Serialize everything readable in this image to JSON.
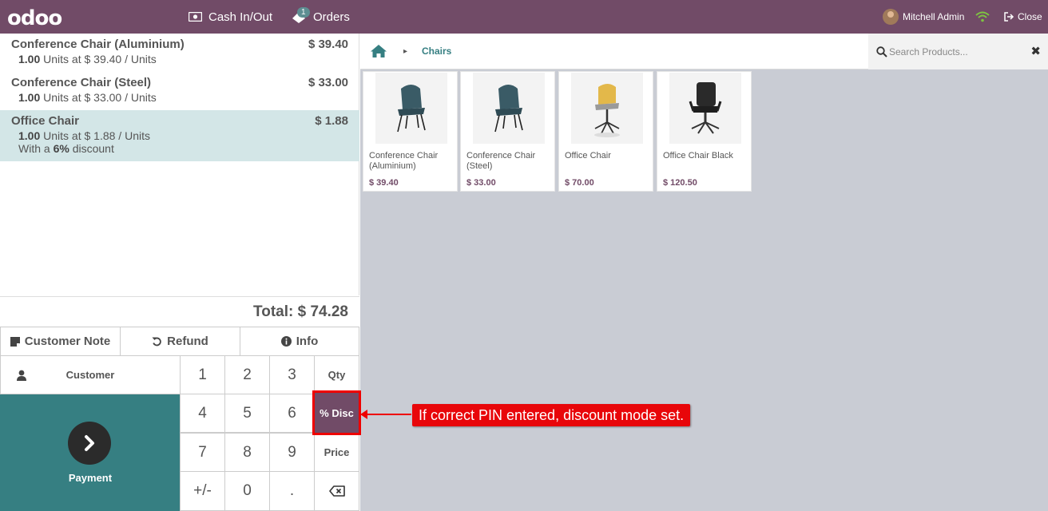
{
  "topbar": {
    "logo": "odoo",
    "cash_label": "Cash In/Out",
    "orders_label": "Orders",
    "orders_badge": "1",
    "user_name": "Mitchell Admin",
    "close_label": "Close"
  },
  "order": {
    "lines": [
      {
        "name": "Conference Chair (Aluminium)",
        "price": "$ 39.40",
        "qty": "1.00",
        "unit_info": "Units at $ 39.40 / Units"
      },
      {
        "name": "Conference Chair (Steel)",
        "price": "$ 33.00",
        "qty": "1.00",
        "unit_info": "Units at $ 33.00 / Units"
      },
      {
        "name": "Office Chair",
        "price": "$ 1.88",
        "qty": "1.00",
        "unit_info": "Units at $ 1.88 / Units",
        "disc_prefix": "With a",
        "disc_value": "6%",
        "disc_suffix": "discount"
      }
    ],
    "total": "Total: $ 74.28"
  },
  "controls": {
    "customer_note": "Customer Note",
    "refund": "Refund",
    "info": "Info",
    "customer": "Customer",
    "payment": "Payment"
  },
  "numpad": {
    "k1": "1",
    "k2": "2",
    "k3": "3",
    "qty": "Qty",
    "k4": "4",
    "k5": "5",
    "k6": "6",
    "disc": "% Disc",
    "k7": "7",
    "k8": "8",
    "k9": "9",
    "price": "Price",
    "plusminus": "+/-",
    "k0": "0",
    "dot": "."
  },
  "products_bar": {
    "crumb": "Chairs",
    "search_placeholder": "Search Products..."
  },
  "products": [
    {
      "name": "Conference Chair (Aluminium)",
      "price": "$ 39.40"
    },
    {
      "name": "Conference Chair (Steel)",
      "price": "$ 33.00"
    },
    {
      "name": "Office Chair",
      "price": "$ 70.00"
    },
    {
      "name": "Office Chair Black",
      "price": "$ 120.50"
    }
  ],
  "annotation": {
    "text": "If correct PIN entered, discount mode set."
  },
  "colors": {
    "brand": "#714b67",
    "teal": "#367f82",
    "selected_line": "#d3e6e7",
    "annotation": "#e8060a"
  }
}
